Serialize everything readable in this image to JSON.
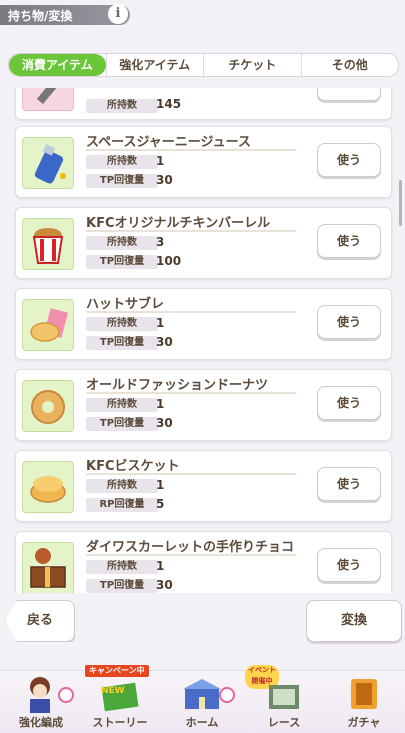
{
  "header": {
    "title": "持ち物/変換",
    "info_label": "i"
  },
  "tabs": [
    {
      "label": "消費アイテム",
      "active": true
    },
    {
      "label": "強化アイテム",
      "active": false
    },
    {
      "label": "チケット",
      "active": false
    },
    {
      "label": "その他",
      "active": false
    }
  ],
  "use_label": "使う",
  "items": [
    {
      "name": "",
      "stat1_label": "所持数",
      "stat1_value": "",
      "stat2_label": "",
      "stat2_value": "",
      "icon": "wrench-icon",
      "partial_top_value": "145"
    },
    {
      "name": "スペースジャーニージュース",
      "stat1_label": "所持数",
      "stat1_value": "1",
      "stat2_label": "TP回復量",
      "stat2_value": "30",
      "icon": "juice-bottle-icon"
    },
    {
      "name": "KFCオリジナルチキンバーレル",
      "stat1_label": "所持数",
      "stat1_value": "3",
      "stat2_label": "TP回復量",
      "stat2_value": "100",
      "icon": "chicken-bucket-icon"
    },
    {
      "name": "ハットサブレ",
      "stat1_label": "所持数",
      "stat1_value": "1",
      "stat2_label": "TP回復量",
      "stat2_value": "30",
      "icon": "cookie-icon"
    },
    {
      "name": "オールドファッションドーナツ",
      "stat1_label": "所持数",
      "stat1_value": "1",
      "stat2_label": "TP回復量",
      "stat2_value": "30",
      "icon": "donut-icon"
    },
    {
      "name": "KFCビスケット",
      "stat1_label": "所持数",
      "stat1_value": "1",
      "stat2_label": "RP回復量",
      "stat2_value": "5",
      "icon": "biscuit-icon"
    },
    {
      "name": "ダイワスカーレットの手作りチョコ",
      "stat1_label": "所持数",
      "stat1_value": "1",
      "stat2_label": "TP回復量",
      "stat2_value": "30",
      "icon": "chocolate-box-icon"
    }
  ],
  "buttons": {
    "back": "戻る",
    "convert": "変換"
  },
  "footer": {
    "items": [
      {
        "label": "強化編成",
        "icon": "character-icon"
      },
      {
        "label": "ストーリー",
        "icon": "book-icon",
        "tag": "キャンペーン中",
        "tag2": "NEW"
      },
      {
        "label": "ホーム",
        "icon": "home-building-icon"
      },
      {
        "label": "レース",
        "icon": "race-track-icon",
        "tag": "イベント開催中"
      },
      {
        "label": "ガチャ",
        "icon": "gacha-icon"
      }
    ]
  },
  "colors": {
    "accent_green": "#6cc63a",
    "badge_pink": "#e8649a",
    "campaign_red": "#e8461e"
  }
}
